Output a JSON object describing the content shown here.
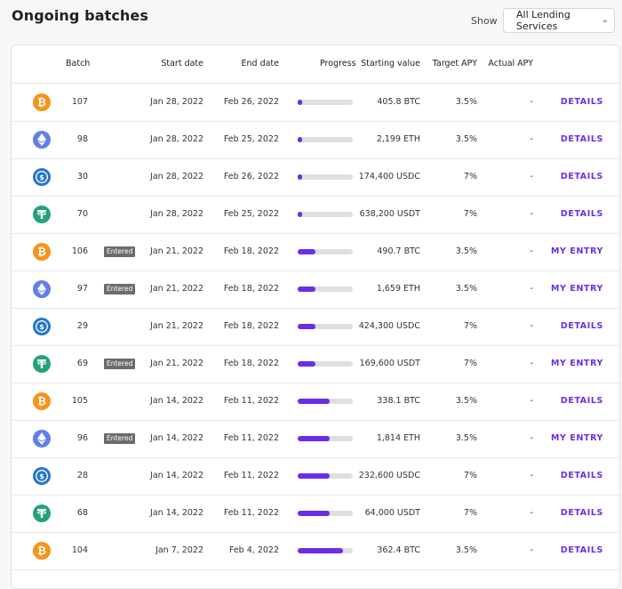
{
  "page": {
    "title": "Ongoing batches"
  },
  "filter": {
    "show_label": "Show",
    "selected": "All Lending Services"
  },
  "table": {
    "headers": {
      "batch": "Batch",
      "start_date": "Start date",
      "end_date": "End date",
      "progress": "Progress",
      "starting_value": "Starting value",
      "target_apy": "Target APY",
      "actual_apy": "Actual APY"
    },
    "rows": [
      {
        "coin": "btc-icon",
        "batch": "107",
        "badge": "",
        "start": "Jan 28, 2022",
        "end": "Feb 26, 2022",
        "progress": 0.08,
        "value": "405.8 BTC",
        "target": "3.5%",
        "actual": "-",
        "action": "DETAILS"
      },
      {
        "coin": "eth-icon",
        "batch": "98",
        "badge": "",
        "start": "Jan 28, 2022",
        "end": "Feb 25, 2022",
        "progress": 0.08,
        "value": "2,199 ETH",
        "target": "3.5%",
        "actual": "-",
        "action": "DETAILS"
      },
      {
        "coin": "usdc-icon",
        "batch": "30",
        "badge": "",
        "start": "Jan 28, 2022",
        "end": "Feb 26, 2022",
        "progress": 0.08,
        "value": "174,400 USDC",
        "target": "7%",
        "actual": "-",
        "action": "DETAILS"
      },
      {
        "coin": "usdt-icon",
        "batch": "70",
        "badge": "",
        "start": "Jan 28, 2022",
        "end": "Feb 25, 2022",
        "progress": 0.08,
        "value": "638,200 USDT",
        "target": "7%",
        "actual": "-",
        "action": "DETAILS"
      },
      {
        "coin": "btc-icon",
        "batch": "106",
        "badge": "Entered",
        "start": "Jan 21, 2022",
        "end": "Feb 18, 2022",
        "progress": 0.33,
        "value": "490.7 BTC",
        "target": "3.5%",
        "actual": "-",
        "action": "MY ENTRY"
      },
      {
        "coin": "eth-icon",
        "batch": "97",
        "badge": "Entered",
        "start": "Jan 21, 2022",
        "end": "Feb 18, 2022",
        "progress": 0.33,
        "value": "1,659 ETH",
        "target": "3.5%",
        "actual": "-",
        "action": "MY ENTRY"
      },
      {
        "coin": "usdc-icon",
        "batch": "29",
        "badge": "",
        "start": "Jan 21, 2022",
        "end": "Feb 18, 2022",
        "progress": 0.33,
        "value": "424,300 USDC",
        "target": "7%",
        "actual": "-",
        "action": "DETAILS"
      },
      {
        "coin": "usdt-icon",
        "batch": "69",
        "badge": "Entered",
        "start": "Jan 21, 2022",
        "end": "Feb 18, 2022",
        "progress": 0.33,
        "value": "169,600 USDT",
        "target": "7%",
        "actual": "-",
        "action": "MY ENTRY"
      },
      {
        "coin": "btc-icon",
        "batch": "105",
        "badge": "",
        "start": "Jan 14, 2022",
        "end": "Feb 11, 2022",
        "progress": 0.58,
        "value": "338.1 BTC",
        "target": "3.5%",
        "actual": "-",
        "action": "DETAILS"
      },
      {
        "coin": "eth-icon",
        "batch": "96",
        "badge": "Entered",
        "start": "Jan 14, 2022",
        "end": "Feb 11, 2022",
        "progress": 0.58,
        "value": "1,814 ETH",
        "target": "3.5%",
        "actual": "-",
        "action": "MY ENTRY"
      },
      {
        "coin": "usdc-icon",
        "batch": "28",
        "badge": "",
        "start": "Jan 14, 2022",
        "end": "Feb 11, 2022",
        "progress": 0.58,
        "value": "232,600 USDC",
        "target": "7%",
        "actual": "-",
        "action": "DETAILS"
      },
      {
        "coin": "usdt-icon",
        "batch": "68",
        "badge": "",
        "start": "Jan 14, 2022",
        "end": "Feb 11, 2022",
        "progress": 0.58,
        "value": "64,000 USDT",
        "target": "7%",
        "actual": "-",
        "action": "DETAILS"
      },
      {
        "coin": "btc-icon",
        "batch": "104",
        "badge": "",
        "start": "Jan 7, 2022",
        "end": "Feb 4, 2022",
        "progress": 0.83,
        "value": "362.4 BTC",
        "target": "3.5%",
        "actual": "-",
        "action": "DETAILS"
      }
    ]
  },
  "colors": {
    "accent": "#6a2ee8",
    "btc": "#f7931a",
    "eth": "#627eea",
    "usdc": "#2775ca",
    "usdt": "#26a17b",
    "badge": "#6b6b70"
  }
}
